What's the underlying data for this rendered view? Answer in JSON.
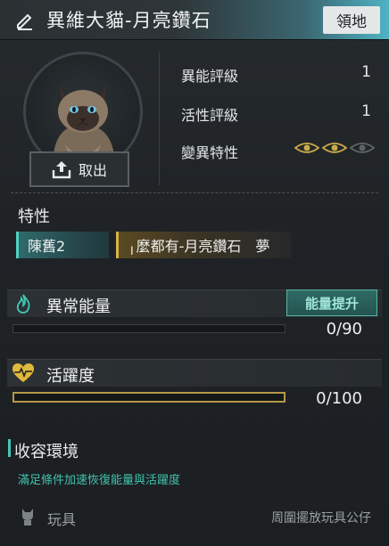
{
  "header": {
    "title": "異維大貓-月亮鑽石",
    "territory_button": "領地"
  },
  "portrait": {
    "take_out_label": "取出"
  },
  "stats": [
    {
      "label": "異能評級",
      "value": "1"
    },
    {
      "label": "活性評級",
      "value": "1"
    },
    {
      "label": "變異特性",
      "active_eyes": 2,
      "total_eyes": 3
    }
  ],
  "traits": {
    "title": "特性",
    "chips": [
      {
        "label": "陳舊2",
        "color": "#4fd0c0"
      },
      {
        "label": "╷麼都有-月亮鑽石　夢",
        "color": "#d6b24c"
      }
    ]
  },
  "energy": {
    "label": "異常能量",
    "boost_button": "能量提升",
    "value": "0/90",
    "fill": 0.0,
    "color": "#42c8b4"
  },
  "activity": {
    "label": "活躍度",
    "value": "0/100",
    "fill": 0.0,
    "color": "#e0b93c"
  },
  "environment": {
    "title": "收容環境",
    "subtitle": "滿足條件加速恢復能量與活躍度",
    "toy_label": "玩具",
    "toy_hint": "周圍擺放玩具公仔"
  }
}
